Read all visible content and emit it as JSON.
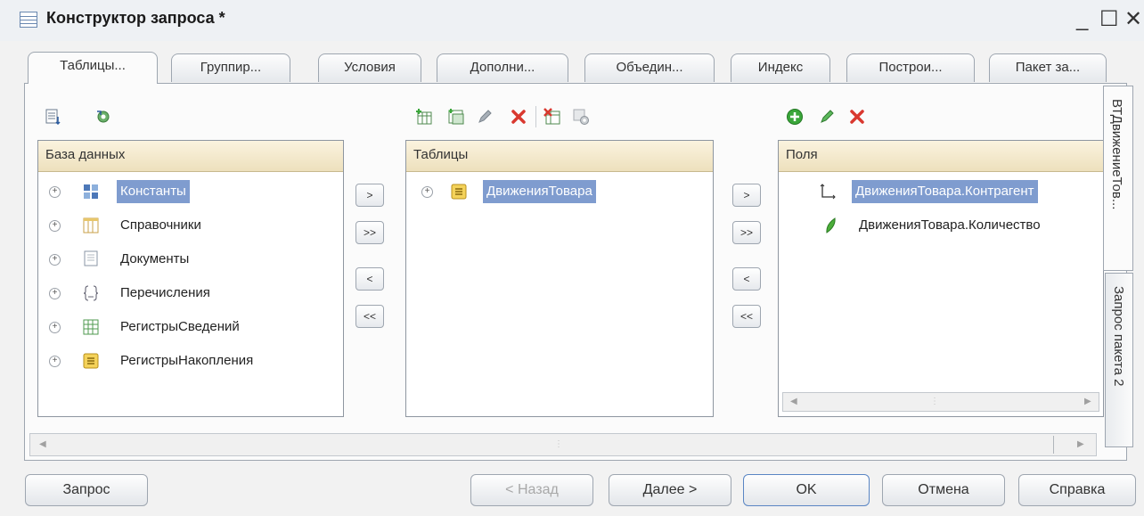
{
  "window": {
    "title": "Конструктор запроса *",
    "minimize": "_",
    "maximize": "☐",
    "close": "✕"
  },
  "tabs": [
    "Таблицы...",
    "Группир...",
    "Условия",
    "Дополни...",
    "Объедин...",
    "Индекс",
    "Построи...",
    "Пакет за..."
  ],
  "database_panel": {
    "header": "База данных",
    "items": [
      {
        "label": "Константы",
        "icon": "constants-icon",
        "selected": true
      },
      {
        "label": "Справочники",
        "icon": "catalogs-icon"
      },
      {
        "label": "Документы",
        "icon": "documents-icon"
      },
      {
        "label": "Перечисления",
        "icon": "enums-icon"
      },
      {
        "label": "РегистрыСведений",
        "icon": "info-registers-icon"
      },
      {
        "label": "РегистрыНакопления",
        "icon": "accum-registers-icon"
      }
    ]
  },
  "tables_panel": {
    "header": "Таблицы",
    "items": [
      {
        "label": "ДвиженияТовара",
        "icon": "accum-register-icon",
        "selected": true
      }
    ]
  },
  "fields_panel": {
    "header": "Поля",
    "items": [
      {
        "label": "ДвиженияТовара.Контрагент",
        "icon": "dimension-icon",
        "selected": true
      },
      {
        "label": "ДвиженияТовара.Количество",
        "icon": "resource-icon"
      }
    ]
  },
  "move_buttons": {
    "add": ">",
    "add_all": ">>",
    "remove": "<",
    "remove_all": "<<"
  },
  "side_tabs": [
    "ВТДвижениеТов...",
    "Запрос пакета 2"
  ],
  "buttons": {
    "query": "Запрос",
    "back": "< Назад",
    "next": "Далее >",
    "ok": "OK",
    "cancel": "Отмена",
    "help": "Справка"
  },
  "colors": {
    "selection": "#7f9ccf",
    "panel_header": "#f4ead0",
    "accent_green": "#3aa63a",
    "delete_red": "#d9382f"
  }
}
